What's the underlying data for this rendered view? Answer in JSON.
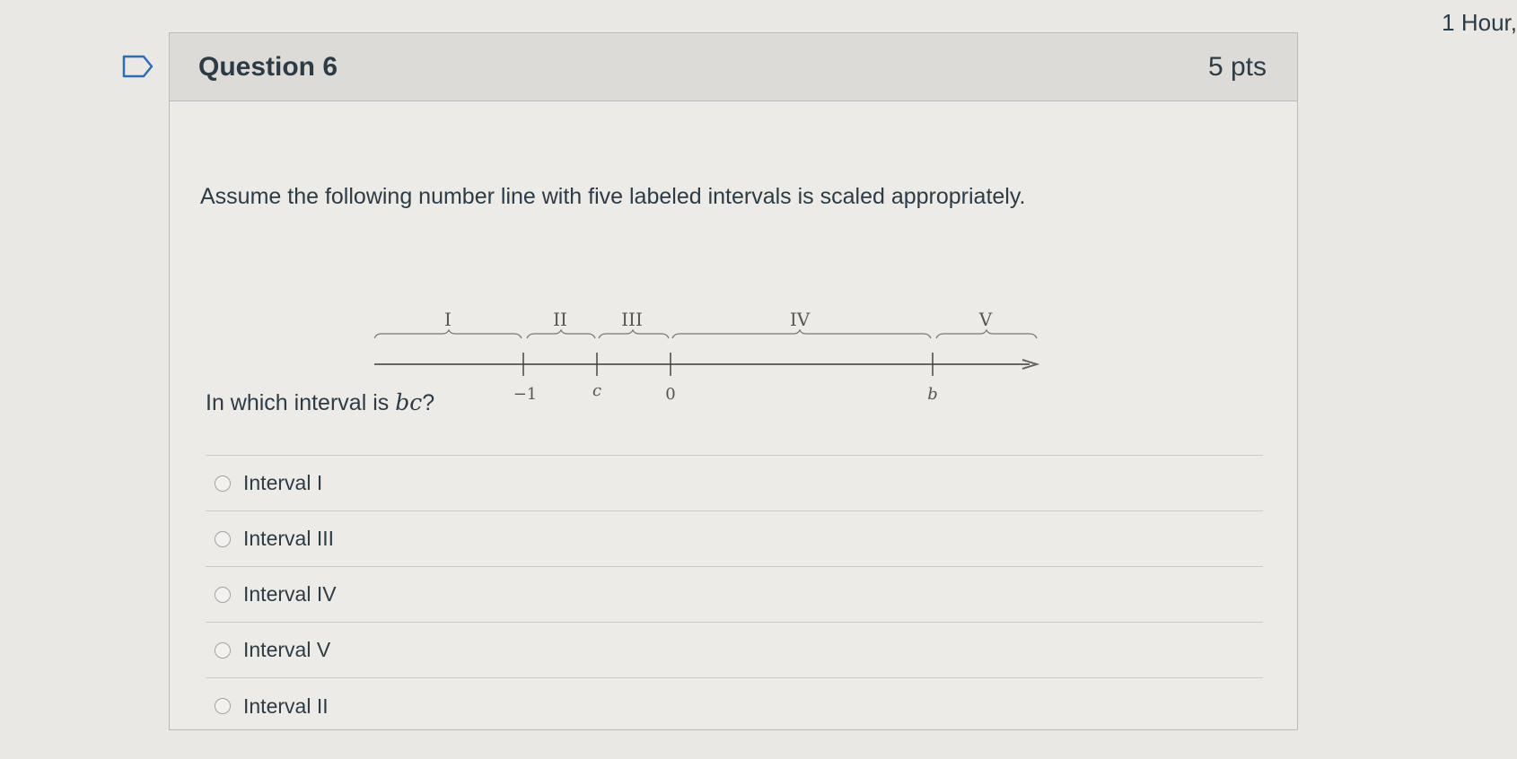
{
  "timer": "1 Hour,",
  "question": {
    "title": "Question 6",
    "points": "5 pts",
    "prompt": "Assume the following number line with five labeled intervals is scaled appropriately.",
    "ask_prefix": "In which interval is ",
    "ask_var": "bc",
    "ask_suffix": "?"
  },
  "number_line": {
    "interval_labels": [
      "I",
      "II",
      "III",
      "IV",
      "V"
    ],
    "tick_labels": [
      "−1",
      "c",
      "0",
      "b"
    ]
  },
  "answers": [
    {
      "label": "Interval I"
    },
    {
      "label": "Interval III"
    },
    {
      "label": "Interval IV"
    },
    {
      "label": "Interval V"
    },
    {
      "label": "Interval II"
    }
  ]
}
